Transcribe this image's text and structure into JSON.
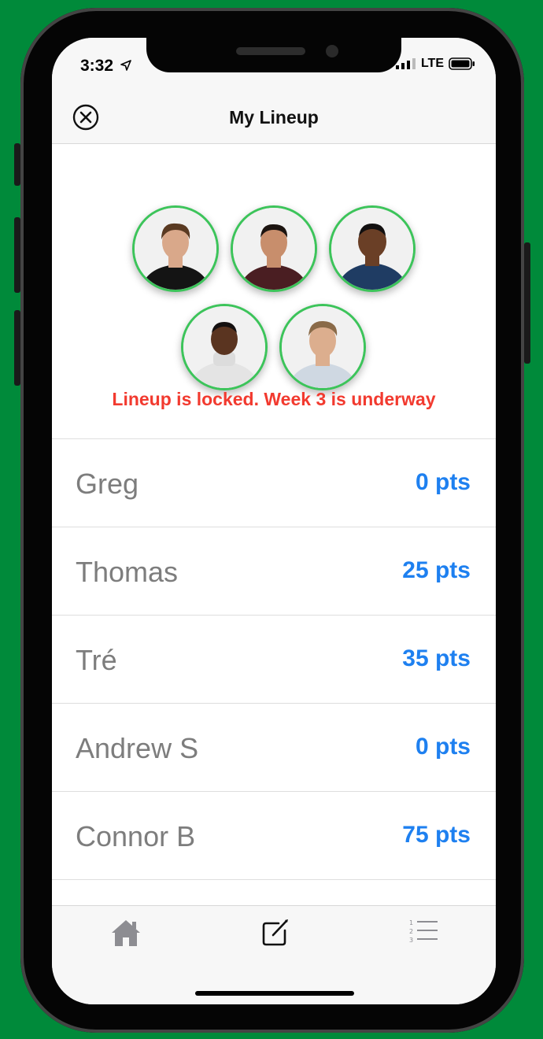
{
  "status_bar": {
    "time": "3:32",
    "network": "LTE"
  },
  "nav": {
    "title": "My Lineup"
  },
  "lineup": {
    "message": "Lineup is locked. Week 3 is underway",
    "rows": [
      {
        "name": "Greg",
        "points": "0 pts"
      },
      {
        "name": "Thomas",
        "points": "25 pts"
      },
      {
        "name": "Tré",
        "points": "35 pts"
      },
      {
        "name": "Andrew S",
        "points": "0 pts"
      },
      {
        "name": "Connor B",
        "points": "75 pts"
      }
    ]
  },
  "avatars": [
    {
      "icon": "person-photo",
      "skin": "#d9a88a",
      "hair": "#5a3a22",
      "shirt": "#141414"
    },
    {
      "icon": "person-photo",
      "skin": "#c88e6c",
      "hair": "#1c1410",
      "shirt": "#4a1e22"
    },
    {
      "icon": "person-photo",
      "skin": "#6a3f26",
      "hair": "#121010",
      "shirt": "#1f3c63"
    },
    {
      "icon": "person-photo",
      "skin": "#5a3420",
      "hair": "#141010",
      "shirt": "#e4e4e4"
    },
    {
      "icon": "person-photo",
      "skin": "#dcae8e",
      "hair": "#8a6a48",
      "shirt": "#cfd8e2"
    }
  ],
  "colors": {
    "brand_green": "#008a3a",
    "avatar_ring": "#3cc45a",
    "alert_red": "#f23a2f",
    "points_blue": "#1e80f0"
  },
  "tabs": [
    {
      "icon": "home-icon"
    },
    {
      "icon": "compose-icon"
    },
    {
      "icon": "numbered-list-icon"
    }
  ]
}
